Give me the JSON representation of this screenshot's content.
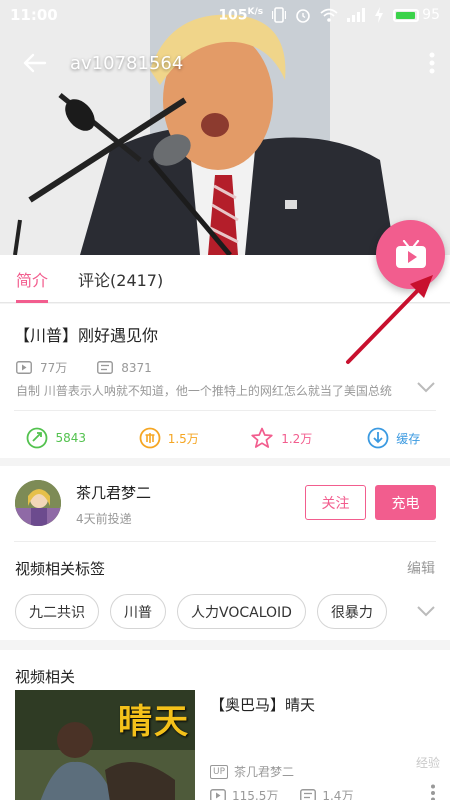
{
  "status_bar": {
    "time": "11:00",
    "speed": "105",
    "speed_unit": "K/s",
    "battery": "95",
    "battery_level": 0.95,
    "icons": [
      "vibrate-icon",
      "alarm-icon",
      "wifi-icon",
      "signal-icon",
      "charging-icon",
      "battery-icon"
    ]
  },
  "header": {
    "video_id": "av10781564",
    "back_icon": "arrow-left-icon",
    "menu_icon": "more-vertical-icon"
  },
  "tabs": [
    {
      "label": "简介",
      "active": true
    },
    {
      "label": "评论(2417)",
      "active": false
    }
  ],
  "video": {
    "title": "【川普】刚好遇见你",
    "plays": "77万",
    "danmaku": "8371",
    "description": "自制 川普表示人呐就不知道，他一个推特上的网红怎么就当了美国总统",
    "actions": [
      {
        "icon": "coin-icon",
        "value": "5843",
        "color": "#53c24f"
      },
      {
        "icon": "coin-yuan-icon",
        "value": "1.5万",
        "color": "#f5a623"
      },
      {
        "icon": "star-icon",
        "value": "1.2万",
        "color": "#f25d8e"
      },
      {
        "icon": "download-icon",
        "value": "缓存",
        "color": "#3b9ae1"
      }
    ]
  },
  "uploader": {
    "name": "茶几君梦二",
    "posted": "4天前投递",
    "follow_label": "关注",
    "charge_label": "充电"
  },
  "tags": {
    "heading": "视频相关标签",
    "edit_label": "编辑",
    "items": [
      "九二共识",
      "川普",
      "人力VOCALOID",
      "很暴力"
    ]
  },
  "related": {
    "heading": "视频相关",
    "items": [
      {
        "thumb_text": "晴天",
        "title": "【奥巴马】晴天",
        "up_badge": "UP",
        "uploader": "茶几君梦二",
        "plays": "115.5万",
        "danmaku": "1.4万"
      }
    ]
  },
  "watermark": "经验",
  "colors": {
    "accent": "#f25d8e",
    "muted": "#999999",
    "annotation_arrow": "#c8102e"
  }
}
